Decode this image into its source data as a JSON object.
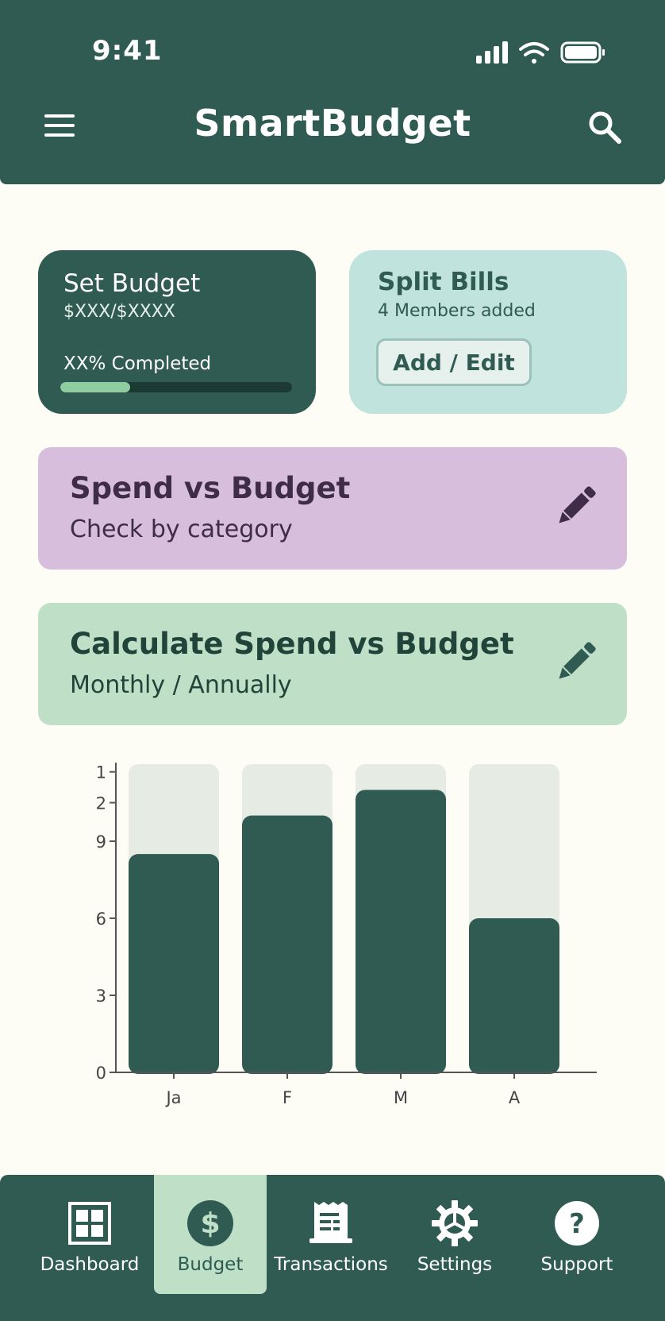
{
  "status_bar": {
    "time": "9:41"
  },
  "header": {
    "title": "SmartBudget"
  },
  "budget_card": {
    "title": "Set Budget",
    "amount": "$XXX/$XXXX",
    "progress_text": "XX% Completed",
    "progress_fraction": 0.3
  },
  "split_card": {
    "title": "Split Bills",
    "subtitle": "4 Members added",
    "button_label": "Add / Edit"
  },
  "spend_card": {
    "title": "Spend vs Budget",
    "subtitle": "Check by category"
  },
  "calc_card": {
    "title": "Calculate Spend vs Budget",
    "subtitle": "Monthly / Annually"
  },
  "chart_data": {
    "type": "bar",
    "categories": [
      "Ja",
      "F",
      "M",
      "A"
    ],
    "values": [
      8.5,
      10.0,
      11.0,
      6.0
    ],
    "budget": [
      12,
      12,
      12,
      12
    ],
    "ylim": [
      0,
      12
    ],
    "y_tick_values": [
      0,
      3,
      6,
      9,
      10.5,
      11.7
    ],
    "y_tick_labels": [
      "0",
      "3",
      "6",
      "9",
      "2",
      "1"
    ],
    "title": "",
    "xlabel": "",
    "ylabel": "",
    "colors": {
      "spend": "#2F5B52",
      "budget": "#E6ECE4"
    }
  },
  "nav": {
    "items": [
      {
        "label": "Dashboard",
        "icon": "dashboard-icon"
      },
      {
        "label": "Budget",
        "icon": "dollar-icon"
      },
      {
        "label": "Transactions",
        "icon": "receipt-icon"
      },
      {
        "label": "Settings",
        "icon": "gear-icon"
      },
      {
        "label": "Support",
        "icon": "help-icon"
      }
    ],
    "active_index": 1
  },
  "colors": {
    "primary": "#2F5B52",
    "background": "#FDFDF5",
    "split_card": "#C1E3DD",
    "spend_card": "#D7BEDC",
    "calc_card": "#C0DFC7",
    "progress": "#8FCCA2"
  }
}
